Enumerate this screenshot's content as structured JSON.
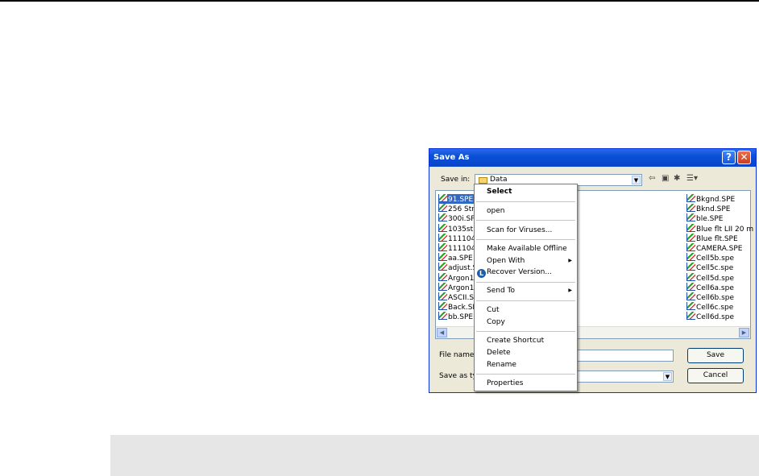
{
  "dialog": {
    "title": "Save As",
    "help_glyph": "?",
    "close_glyph": "✕",
    "save_in_label": "Save in:",
    "save_in_value": "Data",
    "file_name_label": "File name:",
    "file_name_value": "",
    "save_as_type_label": "Save as type:",
    "save_as_type_value": "",
    "save_button": "Save",
    "cancel_button": "Cancel"
  },
  "files": {
    "left": [
      "91.SPE",
      "256 Str",
      "300i.SP",
      "1035st",
      "111104",
      "111104",
      "aa.SPE",
      "adjust.S",
      "Argon1",
      "Argon1",
      "ASCII.S",
      "Back.SP",
      "bb.SPE"
    ],
    "right": [
      "Bkgnd.SPE",
      "Bknd.SPE",
      "ble.SPE",
      "Blue flt LII 20 m",
      "Blue flt.SPE",
      "CAMERA.SPE",
      "Cell5b.spe",
      "Cell5c.spe",
      "Cell5d.spe",
      "Cell6a.spe",
      "Cell6b.spe",
      "Cell6c.spe",
      "Cell6d.spe"
    ]
  },
  "context_menu": {
    "select": "Select",
    "open": "open",
    "scan": "Scan for Viruses...",
    "offline": "Make Available Offline",
    "open_with": "Open With",
    "recover": "Recover Version...",
    "send_to": "Send To",
    "cut": "Cut",
    "copy": "Copy",
    "shortcut": "Create Shortcut",
    "delete": "Delete",
    "rename": "Rename",
    "properties": "Properties",
    "recover_badge": "L"
  },
  "colors": {
    "titlebar": "#0a4fd8",
    "selection": "#316ac5",
    "dialog_bg": "#ece9d8"
  }
}
